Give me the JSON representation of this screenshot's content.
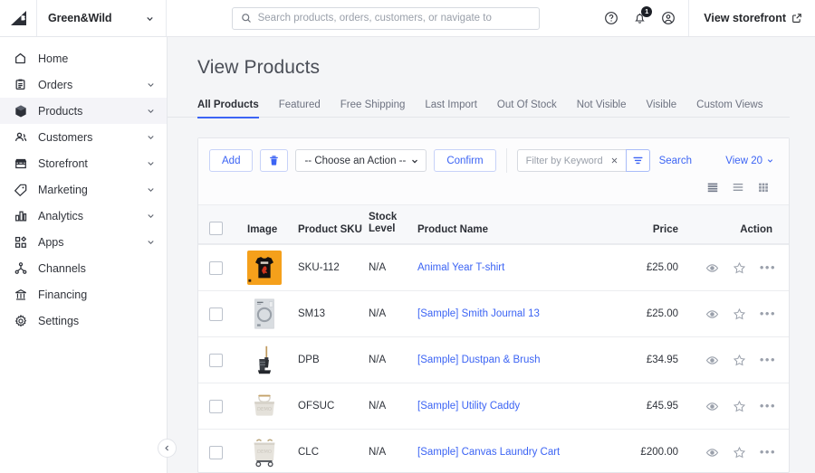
{
  "topbar": {
    "logo_name": "bigcommerce-logo",
    "store_name": "Green&Wild",
    "search_placeholder": "Search products, orders, customers, or navigate to",
    "help_icon": "help-circle-icon",
    "notifications_icon": "bell-icon",
    "notification_count": "1",
    "account_icon": "account-circle-icon",
    "storefront_label": "View storefront",
    "storefront_icon": "external-link-icon"
  },
  "sidebar": {
    "items": [
      {
        "label": "Home",
        "icon": "home-icon",
        "caret": false,
        "active": false
      },
      {
        "label": "Orders",
        "icon": "clipboard-icon",
        "caret": true,
        "active": false
      },
      {
        "label": "Products",
        "icon": "box-icon",
        "caret": true,
        "active": true
      },
      {
        "label": "Customers",
        "icon": "users-icon",
        "caret": true,
        "active": false
      },
      {
        "label": "Storefront",
        "icon": "storefront-icon",
        "caret": true,
        "active": false
      },
      {
        "label": "Marketing",
        "icon": "tag-icon",
        "caret": true,
        "active": false
      },
      {
        "label": "Analytics",
        "icon": "bar-chart-icon",
        "caret": true,
        "active": false
      },
      {
        "label": "Apps",
        "icon": "apps-grid-icon",
        "caret": true,
        "active": false
      },
      {
        "label": "Channels",
        "icon": "share-nodes-icon",
        "caret": false,
        "active": false
      },
      {
        "label": "Financing",
        "icon": "bank-icon",
        "caret": false,
        "active": false
      },
      {
        "label": "Settings",
        "icon": "gear-icon",
        "caret": false,
        "active": false
      }
    ],
    "collapse_icon": "chevron-left-icon"
  },
  "page": {
    "title": "View Products",
    "tabs": [
      {
        "label": "All Products",
        "active": true
      },
      {
        "label": "Featured",
        "active": false
      },
      {
        "label": "Free Shipping",
        "active": false
      },
      {
        "label": "Last Import",
        "active": false
      },
      {
        "label": "Out Of Stock",
        "active": false
      },
      {
        "label": "Not Visible",
        "active": false
      },
      {
        "label": "Visible",
        "active": false
      },
      {
        "label": "Custom Views",
        "active": false
      }
    ]
  },
  "toolbar": {
    "add_label": "Add",
    "delete_icon": "trash-icon",
    "action_select_value": "-- Choose an Action --",
    "confirm_label": "Confirm",
    "filter_placeholder": "Filter by Keyword",
    "filter_clear_icon": "close-icon",
    "filter_icon": "funnel-icon",
    "search_label": "Search",
    "view_count_label": "View 20",
    "view_count_caret": "chevron-down-icon",
    "view_toggles": [
      {
        "icon": "list-compact-icon",
        "active": true
      },
      {
        "icon": "list-comfortable-icon",
        "active": false
      },
      {
        "icon": "grid-view-icon",
        "active": false
      }
    ]
  },
  "table": {
    "select_all_name": "select-all-checkbox",
    "columns": [
      "Image",
      "Product SKU",
      "Stock Level",
      "Product Name",
      "Price",
      "Action"
    ],
    "headers": {
      "image": "Image",
      "sku": "Product SKU",
      "stock_line1": "Stock",
      "stock_line2": "Level",
      "name": "Product Name",
      "price": "Price",
      "action": "Action"
    },
    "row_actions": {
      "preview_icon": "eye-icon",
      "favorite_icon": "star-outline-icon",
      "more_icon": "ellipsis-icon"
    },
    "rows": [
      {
        "sku": "SKU-112",
        "stock": "N/A",
        "name": "Animal Year T-shirt",
        "price": "£25.00",
        "thumb": "tshirt"
      },
      {
        "sku": "SM13",
        "stock": "N/A",
        "name": "[Sample] Smith Journal 13",
        "price": "£25.00",
        "thumb": "journal"
      },
      {
        "sku": "DPB",
        "stock": "N/A",
        "name": "[Sample] Dustpan & Brush",
        "price": "£34.95",
        "thumb": "dustpan"
      },
      {
        "sku": "OFSUC",
        "stock": "N/A",
        "name": "[Sample] Utility Caddy",
        "price": "£45.95",
        "thumb": "caddy"
      },
      {
        "sku": "CLC",
        "stock": "N/A",
        "name": "[Sample] Canvas Laundry Cart",
        "price": "£200.00",
        "thumb": "cart"
      }
    ]
  },
  "colors": {
    "accent": "#3c64f4",
    "page_bg": "#f4f5f7",
    "text": "#2f333b",
    "muted": "#6d7280"
  }
}
